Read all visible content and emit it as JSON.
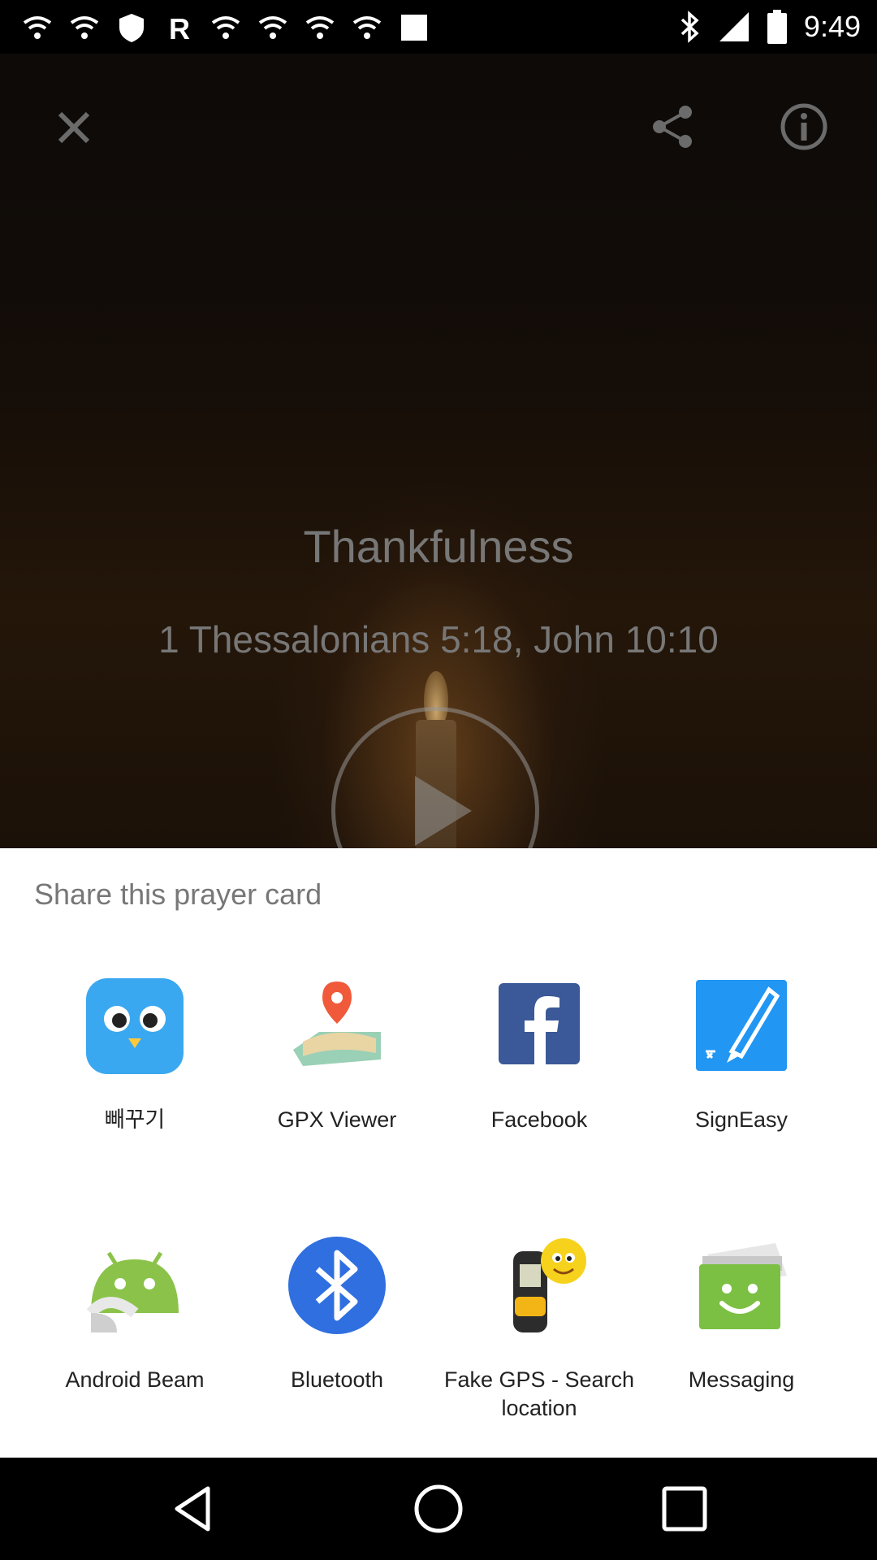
{
  "status_bar": {
    "time": "9:49",
    "notification_icons": [
      "wifi-icon",
      "wifi-icon",
      "shield-icon",
      "r-app-icon",
      "wifi-icon",
      "wifi-icon",
      "wifi-icon",
      "wifi-icon",
      "blank-icon"
    ],
    "system_icons": [
      "bluetooth-icon",
      "signal-icon",
      "battery-icon"
    ]
  },
  "card": {
    "title": "Thankfulness",
    "reference": "1 Thessalonians 5:18, John 10:10"
  },
  "share_sheet": {
    "title": "Share this prayer card",
    "apps": [
      {
        "label": "빼꾸기",
        "icon": "bird-face-icon"
      },
      {
        "label": "GPX Viewer",
        "icon": "map-pin-icon"
      },
      {
        "label": "Facebook",
        "icon": "facebook-icon"
      },
      {
        "label": "SignEasy",
        "icon": "pen-icon"
      },
      {
        "label": "Android Beam",
        "icon": "android-icon"
      },
      {
        "label": "Bluetooth",
        "icon": "bluetooth-icon"
      },
      {
        "label": "Fake GPS - Search location",
        "icon": "gps-device-icon"
      },
      {
        "label": "Messaging",
        "icon": "message-icon"
      }
    ]
  },
  "colors": {
    "sheet_bg": "#ffffff",
    "label_text": "#222222",
    "title_text": "#777777",
    "facebook_blue": "#3b5998",
    "bluetooth_blue": "#2f6fe0",
    "android_green": "#8bc34a",
    "signeasy_blue": "#2196f3"
  }
}
